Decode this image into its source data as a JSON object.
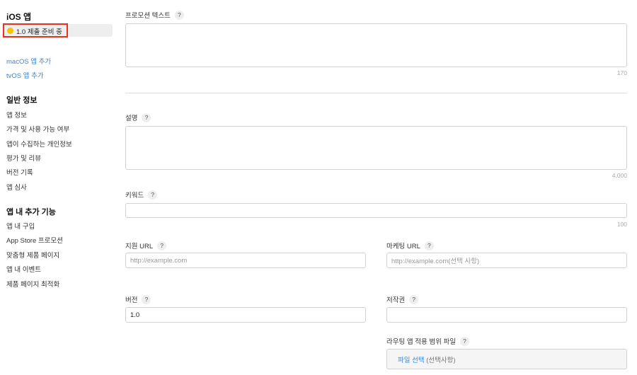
{
  "sidebar": {
    "ios_title": "iOS 앱",
    "version_status": "1.0 제출 준비 중",
    "status_color": "#f5c400",
    "highlight_color": "#e8321e",
    "add_macos": "macOS 앱 추가",
    "add_tvos": "tvOS 앱 추가",
    "general_title": "일반 정보",
    "general_items": [
      "앱 정보",
      "가격 및 사용 가능 여부",
      "앱이 수집하는 개인정보",
      "평가 및 리뷰",
      "버전 기록",
      "앱 심사"
    ],
    "inapp_title": "앱 내 추가 기능",
    "inapp_items": [
      "앱 내 구입",
      "App Store 프로모션",
      "맞춤형 제품 페이지",
      "앱 내 이벤트",
      "제품 페이지 최적화"
    ]
  },
  "form": {
    "help": "?",
    "promo_label": "프로모션 텍스트",
    "promo_count": "170",
    "desc_label": "설명",
    "desc_count": "4,000",
    "keywords_label": "키워드",
    "keywords_count": "100",
    "support_label": "지원 URL",
    "support_placeholder": "http://example.com",
    "marketing_label": "마케팅 URL",
    "marketing_placeholder": "http://example.com(선택 사항)",
    "version_label": "버전",
    "version_value": "1.0",
    "copyright_label": "저작권",
    "routing_label": "라우팅 앱 적용 범위 파일",
    "routing_choose": "파일 선택",
    "routing_optional": "(선택사항)"
  }
}
